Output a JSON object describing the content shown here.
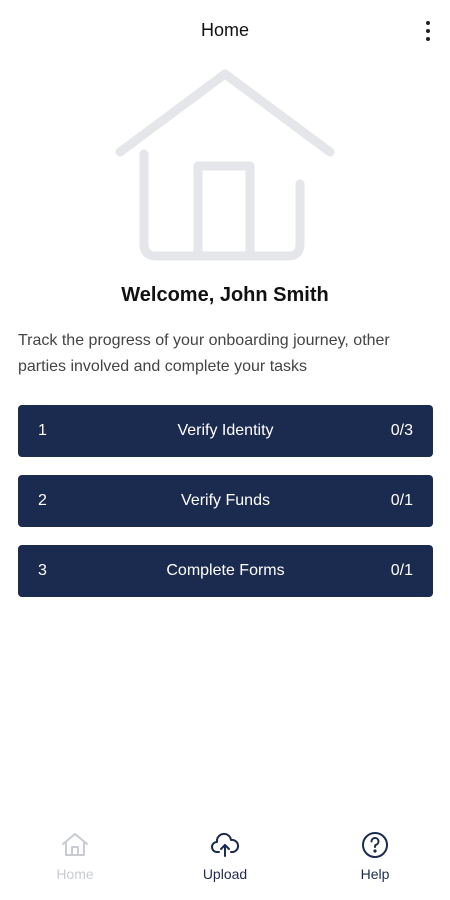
{
  "app_bar": {
    "title": "Home",
    "more_icon": "more-vertical-icon"
  },
  "hero": {
    "icon": "house-icon"
  },
  "welcome": "Welcome, John Smith",
  "description": "Track the progress of your onboarding journey, other parties involved and complete your tasks",
  "tasks": [
    {
      "number": "1",
      "label": "Verify Identity",
      "count": "0/3"
    },
    {
      "number": "2",
      "label": "Verify Funds",
      "count": "0/1"
    },
    {
      "number": "3",
      "label": "Complete Forms",
      "count": "0/1"
    }
  ],
  "bottom_nav": [
    {
      "label": "Home",
      "icon": "home-icon",
      "active": false
    },
    {
      "label": "Upload",
      "icon": "cloud-upload-icon",
      "active": true
    },
    {
      "label": "Help",
      "icon": "help-circle-icon",
      "active": true
    }
  ],
  "colors": {
    "task_bg": "#1b2a4f",
    "nav_disabled": "#c9ccd3",
    "hero_stroke": "#e4e6ea"
  }
}
